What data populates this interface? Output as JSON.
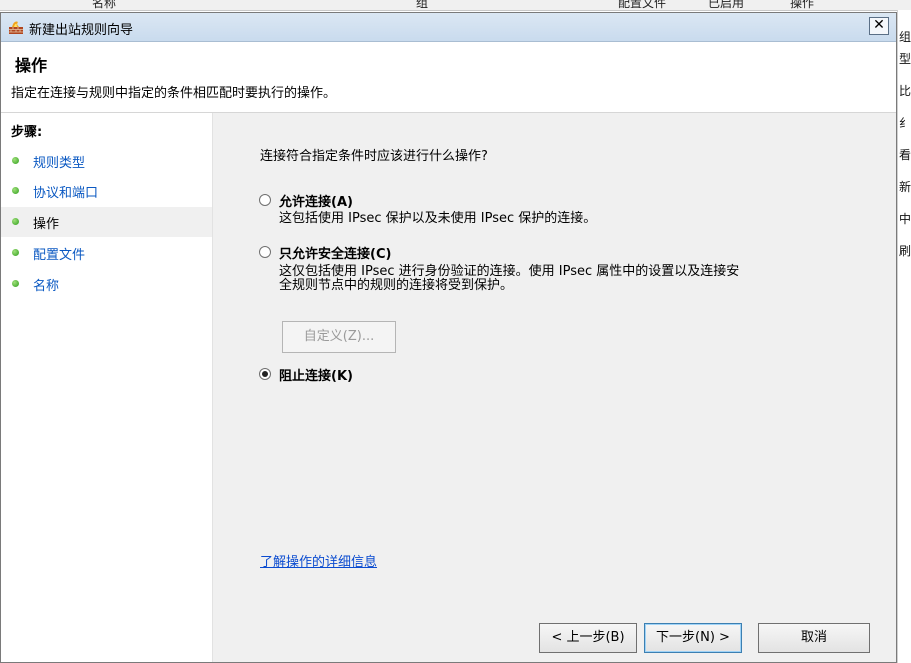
{
  "background_window": {
    "column_headers": [
      "名称",
      "组",
      "配置文件",
      "已启用",
      "操作"
    ],
    "right_edge_chars": [
      "组",
      "型",
      "比",
      "纟",
      "看",
      "新",
      "中",
      "刷"
    ]
  },
  "dialog": {
    "title": "新建出站规则向导",
    "close_glyph": "✕",
    "page_title": "操作",
    "page_description": "指定在连接与规则中指定的条件相匹配时要执行的操作。"
  },
  "sidebar": {
    "steps_title": "步骤:",
    "items": [
      {
        "label": "规则类型",
        "active": false
      },
      {
        "label": "协议和端口",
        "active": false
      },
      {
        "label": "操作",
        "active": true
      },
      {
        "label": "配置文件",
        "active": false
      },
      {
        "label": "名称",
        "active": false
      }
    ]
  },
  "main": {
    "question": "连接符合指定条件时应该进行什么操作?",
    "options": [
      {
        "label": "允许连接(A)",
        "description": [
          "这包括使用 IPsec 保护以及未使用 IPsec 保护的连接。"
        ],
        "selected": false
      },
      {
        "label": "只允许安全连接(C)",
        "description": [
          "这仅包括使用 IPsec 进行身份验证的连接。使用 IPsec 属性中的设置以及连接安",
          "全规则节点中的规则的连接将受到保护。"
        ],
        "selected": false
      },
      {
        "label": "阻止连接(K)",
        "description": [],
        "selected": true
      }
    ],
    "customize_button": "自定义(Z)...",
    "learn_more_link": "了解操作的详细信息"
  },
  "footer": {
    "back_button": "< 上一步(B)",
    "next_button": "下一步(N) >",
    "cancel_button": "取消"
  }
}
